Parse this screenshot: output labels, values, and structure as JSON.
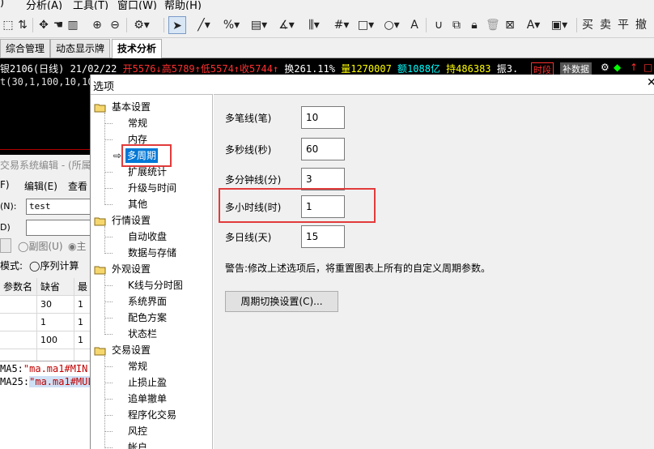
{
  "menubar": {
    "items": [
      "分析(A)",
      "工具(T)",
      "窗口(W)",
      "帮助(H)"
    ]
  },
  "toolbar": {
    "trade_buttons": [
      "买",
      "卖",
      "平",
      "撤"
    ]
  },
  "tabs": [
    "综合管理",
    "动态显示牌",
    "技术分析"
  ],
  "chart": {
    "symbol": "银2106(日线) 21/02/22",
    "open": "开5576",
    "high": "高5789",
    "low": "低5574",
    "close": "收5744",
    "turnover": "换261.11%",
    "volume": "量1270007",
    "amount": "额1088亿",
    "hold": "持486383",
    "amplitude": "振3.",
    "badge1": "时段",
    "badge2": "补数据",
    "params": "t(30,1,100,10,10)"
  },
  "editor": {
    "title": "交易系统编辑 - (所属",
    "menu": [
      "F)",
      "编辑(E)",
      "查看"
    ],
    "name_label": "(N):",
    "name_value": "test",
    "desc_label": "D)",
    "sub_chart_label": "副图(U)",
    "main_chart_label": "主",
    "mode_label": "模式:",
    "mode_option": "序列计算",
    "grid_headers": [
      "参数名",
      "缺省",
      "最"
    ],
    "grid_rows": [
      [
        "",
        "30",
        "1"
      ],
      [
        "",
        "1",
        "1"
      ],
      [
        "",
        "100",
        "1"
      ],
      [
        "",
        "",
        ""
      ]
    ],
    "code_lines": [
      {
        "name": "MA5:",
        "value": "\"ma.ma1#MIN"
      },
      {
        "name": "MA25:",
        "value": "\"ma.ma1#MUL"
      }
    ]
  },
  "dialog": {
    "title": "选项",
    "close_icon": "close-icon",
    "tree": [
      {
        "type": "folder",
        "label": "基本设置"
      },
      {
        "type": "item",
        "label": "常规"
      },
      {
        "type": "item",
        "label": "内存"
      },
      {
        "type": "item",
        "label": "多周期",
        "selected": true
      },
      {
        "type": "item",
        "label": "扩展统计"
      },
      {
        "type": "item",
        "label": "升级与时间"
      },
      {
        "type": "item",
        "label": "其他"
      },
      {
        "type": "folder",
        "label": "行情设置"
      },
      {
        "type": "item",
        "label": "自动收盘"
      },
      {
        "type": "item",
        "label": "数据与存储"
      },
      {
        "type": "folder",
        "label": "外观设置"
      },
      {
        "type": "item",
        "label": "K线与分时图"
      },
      {
        "type": "item",
        "label": "系统界面"
      },
      {
        "type": "item",
        "label": "配色方案"
      },
      {
        "type": "item",
        "label": "状态栏"
      },
      {
        "type": "folder",
        "label": "交易设置"
      },
      {
        "type": "item",
        "label": "常规"
      },
      {
        "type": "item",
        "label": "止损止盈"
      },
      {
        "type": "item",
        "label": "追单撤单"
      },
      {
        "type": "item",
        "label": "程序化交易"
      },
      {
        "type": "item",
        "label": "风控"
      },
      {
        "type": "item",
        "label": "帐户"
      }
    ],
    "fields": [
      {
        "label": "多笔线(笔)",
        "value": "10"
      },
      {
        "label": "多秒线(秒)",
        "value": "60"
      },
      {
        "label": "多分钟线(分)",
        "value": "3"
      },
      {
        "label": "多小时线(时)",
        "value": "1"
      },
      {
        "label": "多日线(天)",
        "value": "15"
      }
    ],
    "warning": "警告:修改上述选项后，将重置图表上所有的自定义周期参数。",
    "cycle_button": "周期切换设置(C)..."
  },
  "colors": {
    "up_red": "#ff3030",
    "down_green": "#00ff00",
    "highlight_red": "#e23b3b",
    "selection_blue": "#0078d7"
  }
}
